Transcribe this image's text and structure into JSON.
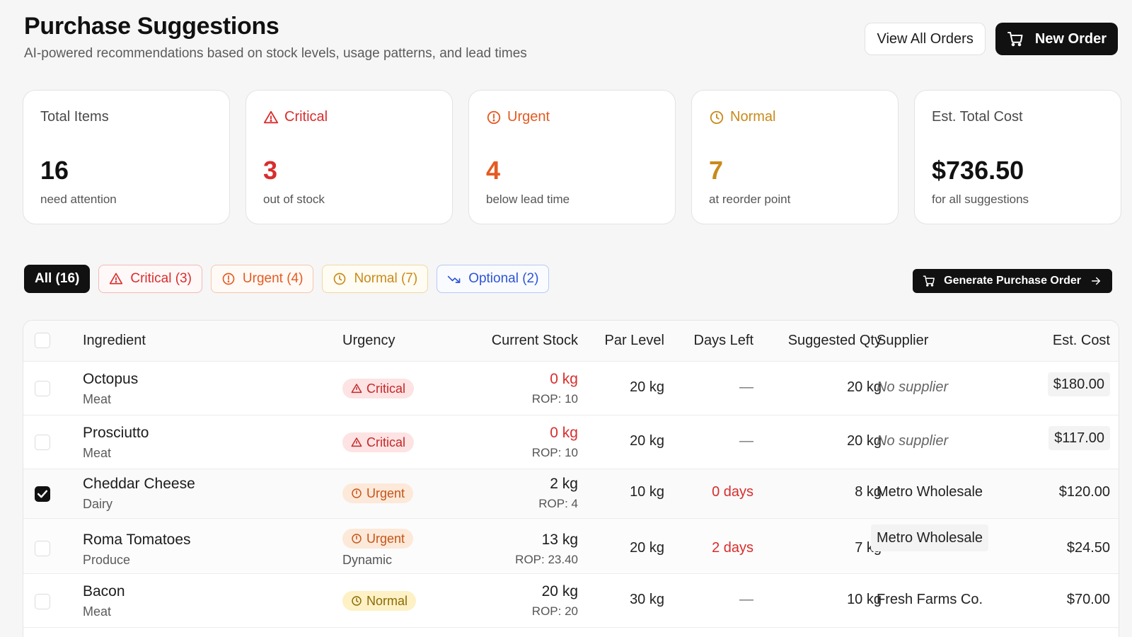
{
  "header": {
    "title": "Purchase Suggestions",
    "subtitle": "AI-powered recommendations based on stock levels, usage patterns, and lead times",
    "view_orders_label": "View All Orders",
    "new_order_label": "New Order"
  },
  "cards": [
    {
      "label": "Total Items",
      "value": "16",
      "note": "need attention"
    },
    {
      "label": "Critical",
      "value": "3",
      "note": "out of stock"
    },
    {
      "label": "Urgent",
      "value": "4",
      "note": "below lead time"
    },
    {
      "label": "Normal",
      "value": "7",
      "note": "at reorder point"
    },
    {
      "label": "Est. Total Cost",
      "value": "$736.50",
      "note": "for all suggestions"
    }
  ],
  "filters": {
    "all": "All (16)",
    "critical": "Critical (3)",
    "urgent": "Urgent (4)",
    "normal": "Normal (7)",
    "optional": "Optional (2)",
    "generate_label": "Generate Purchase Order"
  },
  "table": {
    "columns": [
      "Ingredient",
      "Urgency",
      "Current Stock",
      "Par Level",
      "Days Left",
      "Suggested Qty",
      "Supplier",
      "Est. Cost"
    ],
    "rows": [
      {
        "name": "Octopus",
        "category": "Meat",
        "urgency": "Critical",
        "urgency_note": "",
        "stock": "0 kg",
        "rop": "ROP: 10",
        "par": "20 kg",
        "days": "—",
        "qty": "20 kg",
        "supplier": "No supplier",
        "cost": "$180.00",
        "checked": false
      },
      {
        "name": "Prosciutto",
        "category": "Meat",
        "urgency": "Critical",
        "urgency_note": "",
        "stock": "0 kg",
        "rop": "ROP: 10",
        "par": "20 kg",
        "days": "—",
        "qty": "20 kg",
        "supplier": "No supplier",
        "cost": "$117.00",
        "checked": false
      },
      {
        "name": "Cheddar Cheese",
        "category": "Dairy",
        "urgency": "Urgent",
        "urgency_note": "",
        "stock": "2 kg",
        "rop": "ROP: 4",
        "par": "10 kg",
        "days": "0 days",
        "qty": "8 kg",
        "supplier": "Metro Wholesale",
        "cost": "$120.00",
        "checked": true
      },
      {
        "name": "Roma Tomatoes",
        "category": "Produce",
        "urgency": "Urgent",
        "urgency_note": "Dynamic",
        "stock": "13 kg",
        "rop": "ROP: 23.40",
        "par": "20 kg",
        "days": "2 days",
        "qty": "7 kg",
        "supplier": "Metro Wholesale",
        "cost": "$24.50",
        "checked": false
      },
      {
        "name": "Bacon",
        "category": "Meat",
        "urgency": "Normal",
        "urgency_note": "",
        "stock": "20 kg",
        "rop": "ROP: 20",
        "par": "30 kg",
        "days": "—",
        "qty": "10 kg",
        "supplier": "Fresh Farms Co.",
        "cost": "$70.00",
        "checked": false
      }
    ]
  },
  "colors": {
    "critical": "#d92d2d",
    "urgent": "#e55a22",
    "normal": "#c98a1a",
    "optional": "#2e54d6",
    "primary": "#111111"
  }
}
